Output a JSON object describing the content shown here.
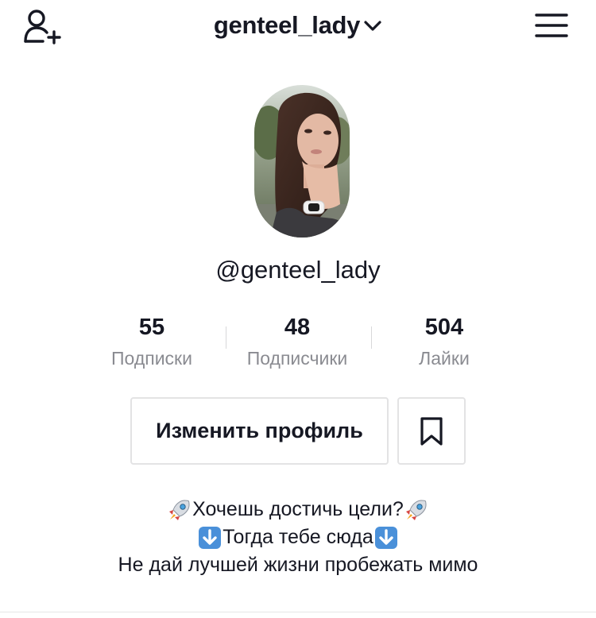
{
  "header": {
    "username": "genteel_lady",
    "add_user_icon": "add-user-icon",
    "chevron_icon": "chevron-down-icon",
    "menu_icon": "hamburger-menu-icon"
  },
  "profile": {
    "avatar_icon": "profile-photo",
    "handle": "@genteel_lady"
  },
  "stats": [
    {
      "value": "55",
      "label": "Подписки"
    },
    {
      "value": "48",
      "label": "Подписчики"
    },
    {
      "value": "504",
      "label": "Лайки"
    }
  ],
  "actions": {
    "edit_profile_label": "Изменить профиль",
    "bookmark_icon": "bookmark-icon"
  },
  "bio": {
    "line1": "Хочешь достичь цели?",
    "line2": "Тогда тебе сюда",
    "line3": "Не дай лучшей жизни пробежать мимо",
    "line1_emoji": "rocket-emoji",
    "line2_emoji": "down-arrow-emoji"
  },
  "colors": {
    "text": "#161823",
    "secondary_text": "#8a8b91",
    "border": "#e3e3e4"
  }
}
